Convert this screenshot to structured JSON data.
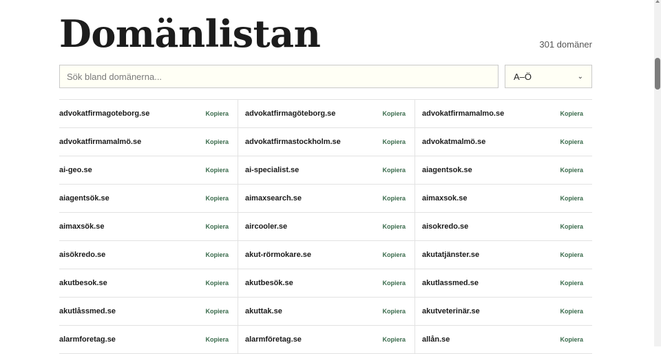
{
  "header": {
    "title": "Domänlistan",
    "count": "301 domäner"
  },
  "search": {
    "placeholder": "Sök bland domänerna...",
    "value": ""
  },
  "sort": {
    "selected": "A–Ö",
    "icon": "chevron-down-icon"
  },
  "copy_label": "Kopiera",
  "domains": [
    "advokatfirmagoteborg.se",
    "advokatfirmagöteborg.se",
    "advokatfirmamalmo.se",
    "advokatfirmamalmö.se",
    "advokatfirmastockholm.se",
    "advokatmalmö.se",
    "ai-geo.se",
    "ai-specialist.se",
    "aiagentsok.se",
    "aiagentsök.se",
    "aimaxsearch.se",
    "aimaxsok.se",
    "aimaxsök.se",
    "aircooler.se",
    "aisokredo.se",
    "aisökredo.se",
    "akut-rörmokare.se",
    "akutatjänster.se",
    "akutbesok.se",
    "akutbesök.se",
    "akutlassmed.se",
    "akutlåssmed.se",
    "akuttak.se",
    "akutveterinär.se",
    "alarmforetag.se",
    "alarmföretag.se",
    "allån.se"
  ],
  "colors": {
    "accent": "#3a6b4c",
    "input_bg": "#fffff5",
    "divider": "#e2e2e2"
  }
}
